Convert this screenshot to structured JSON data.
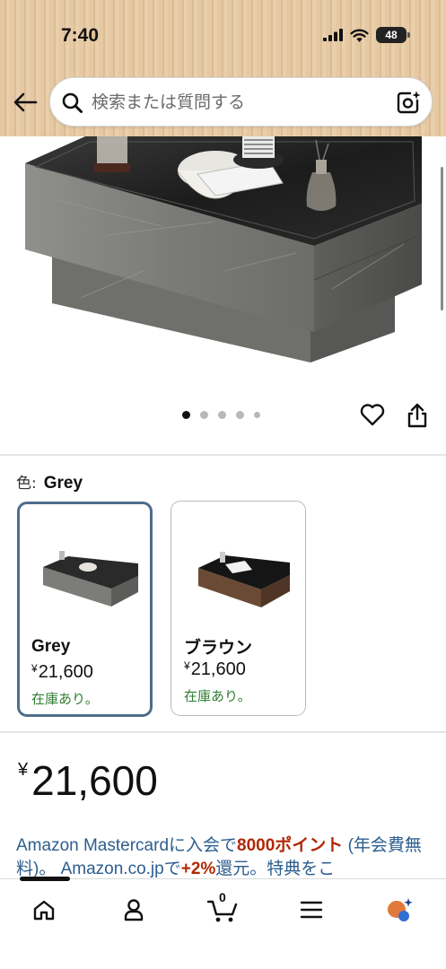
{
  "status_bar": {
    "time": "7:40",
    "battery": "48"
  },
  "search": {
    "placeholder": "検索または質問する"
  },
  "image_gallery": {
    "dot_count": 5,
    "active_index": 0
  },
  "variation": {
    "label": "色:",
    "selected": "Grey",
    "options": [
      {
        "name": "Grey",
        "currency": "¥",
        "price": "21,600",
        "stock": "在庫あり。"
      },
      {
        "name": "ブラウン",
        "currency": "¥",
        "price": "21,600",
        "stock": "在庫あり。"
      }
    ]
  },
  "price": {
    "currency": "¥",
    "amount": "21,600"
  },
  "promo": {
    "part1": "Amazon Mastercardに入会で",
    "highlight": "8000ポイント",
    "part2": " (年会費無料)。 Amazon.co.jpで",
    "percent": "+2%",
    "part3": "還元。特典をこ"
  },
  "bottom_nav": {
    "cart_count": "0"
  },
  "colors": {
    "accent_blue": "#4f6d8c",
    "link": "#2c5e8f",
    "deal_red": "#b12704",
    "in_stock": "#2e7d32"
  }
}
